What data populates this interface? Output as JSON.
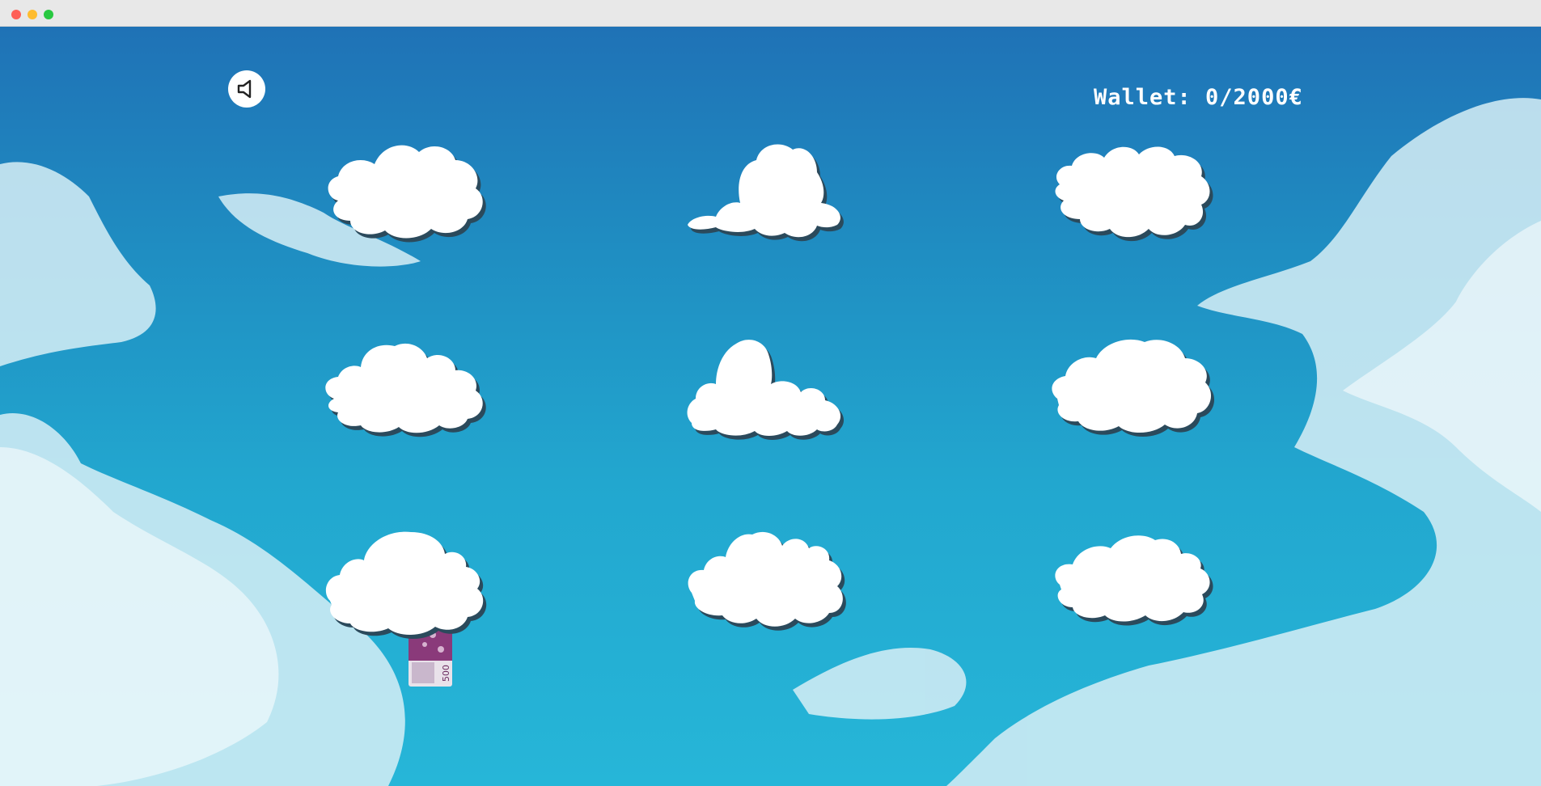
{
  "window": {
    "controls": [
      "close",
      "minimize",
      "maximize"
    ]
  },
  "header": {
    "sound_icon": "speaker-icon",
    "wallet_text": "Wallet: 0/2000€"
  },
  "game": {
    "cloud_grid": {
      "rows": 3,
      "columns": 3
    },
    "clouds": [
      {
        "row": 1,
        "col": 1
      },
      {
        "row": 1,
        "col": 2
      },
      {
        "row": 1,
        "col": 3
      },
      {
        "row": 2,
        "col": 1
      },
      {
        "row": 2,
        "col": 2
      },
      {
        "row": 2,
        "col": 3
      },
      {
        "row": 3,
        "col": 1
      },
      {
        "row": 3,
        "col": 2
      },
      {
        "row": 3,
        "col": 3
      }
    ],
    "revealed_item": {
      "type": "banknote",
      "under_cloud": {
        "row": 3,
        "col": 1
      },
      "denomination_label": "500"
    }
  },
  "colors": {
    "sky_top": "#1f72b6",
    "sky_bottom": "#26b6d8",
    "cloud_fill": "#ffffff",
    "cloud_shadow": "#2b4a5c",
    "banknote": "#8a3a7a",
    "wallet_text": "#ffffff"
  }
}
